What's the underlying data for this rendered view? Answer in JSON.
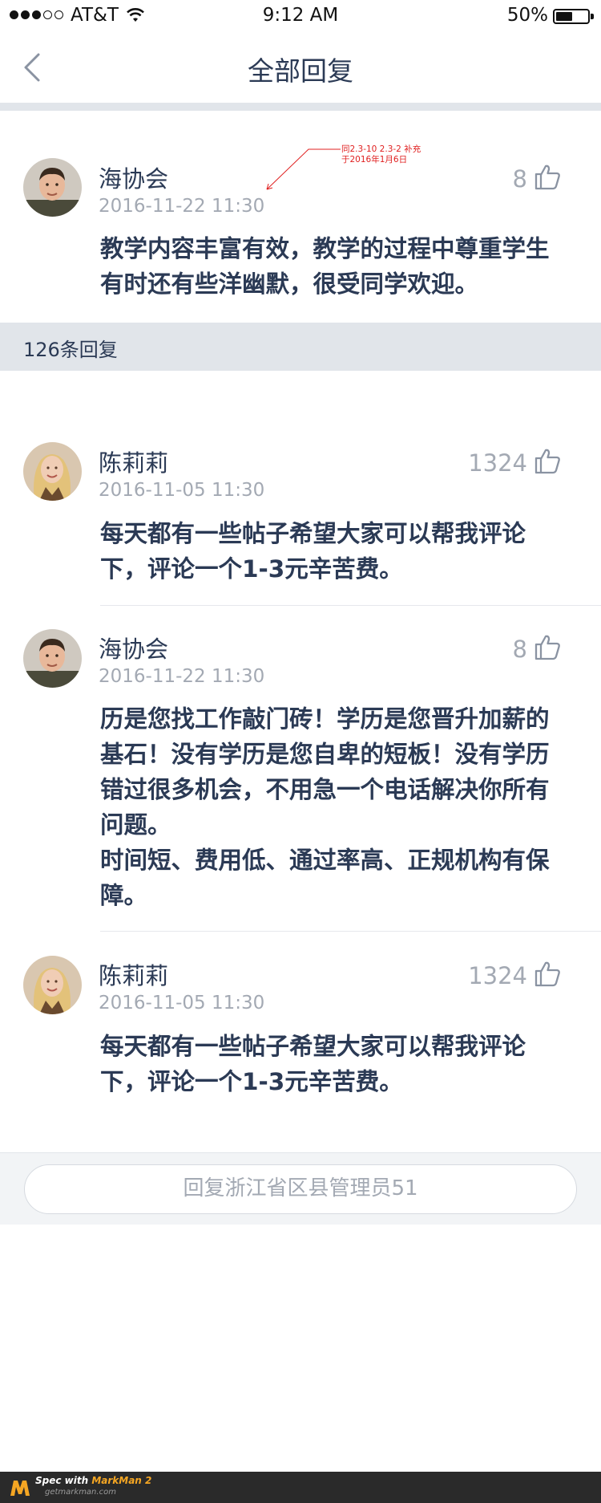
{
  "status_bar": {
    "carrier": "AT&T",
    "time": "9:12 AM",
    "battery": "50%"
  },
  "nav": {
    "title": "全部回复"
  },
  "annotation": {
    "text": "同2.3-10 2.3-2 补充于2016年1月6日"
  },
  "main_comment": {
    "name": "海协会",
    "date": "2016-11-22 11:30",
    "likes": "8",
    "text": "教学内容丰富有效，教学的过程中尊重学生有时还有些洋幽默，很受同学欢迎。"
  },
  "replies_header": {
    "count_label": "126条回复"
  },
  "replies": [
    {
      "name": "陈莉莉",
      "date": "2016-11-05 11:30",
      "likes": "1324",
      "text": "每天都有一些帖子希望大家可以帮我评论下，评论一个1-3元辛苦费。"
    },
    {
      "name": "海协会",
      "date": "2016-11-22 11:30",
      "likes": "8",
      "text": "历是您找工作敲门砖！学历是您晋升加薪的基石！没有学历是您自卑的短板！没有学历错过很多机会，不用急一个电话解决你所有问题。",
      "text2": "时间短、费用低、通过率高、正规机构有保障。"
    },
    {
      "name": "陈莉莉",
      "date": "2016-11-05 11:30",
      "likes": "1324",
      "text": "每天都有一些帖子希望大家可以帮我评论下，评论一个1-3元辛苦费。"
    }
  ],
  "reply_input": {
    "placeholder": "回复浙江省区县管理员51"
  },
  "footer": {
    "brand_prefix": "Spec with ",
    "brand_name": "MarkMan 2",
    "url": "getmarkman.com"
  },
  "colors": {
    "text_primary": "#2b3a55",
    "text_secondary": "#a3a9b3",
    "divider_bg": "#e1e5ea",
    "annotation": "#e02020"
  },
  "icons": {
    "back": "chevron-left-icon",
    "like": "thumbs-up-icon",
    "wifi": "wifi-icon",
    "battery": "battery-icon"
  }
}
